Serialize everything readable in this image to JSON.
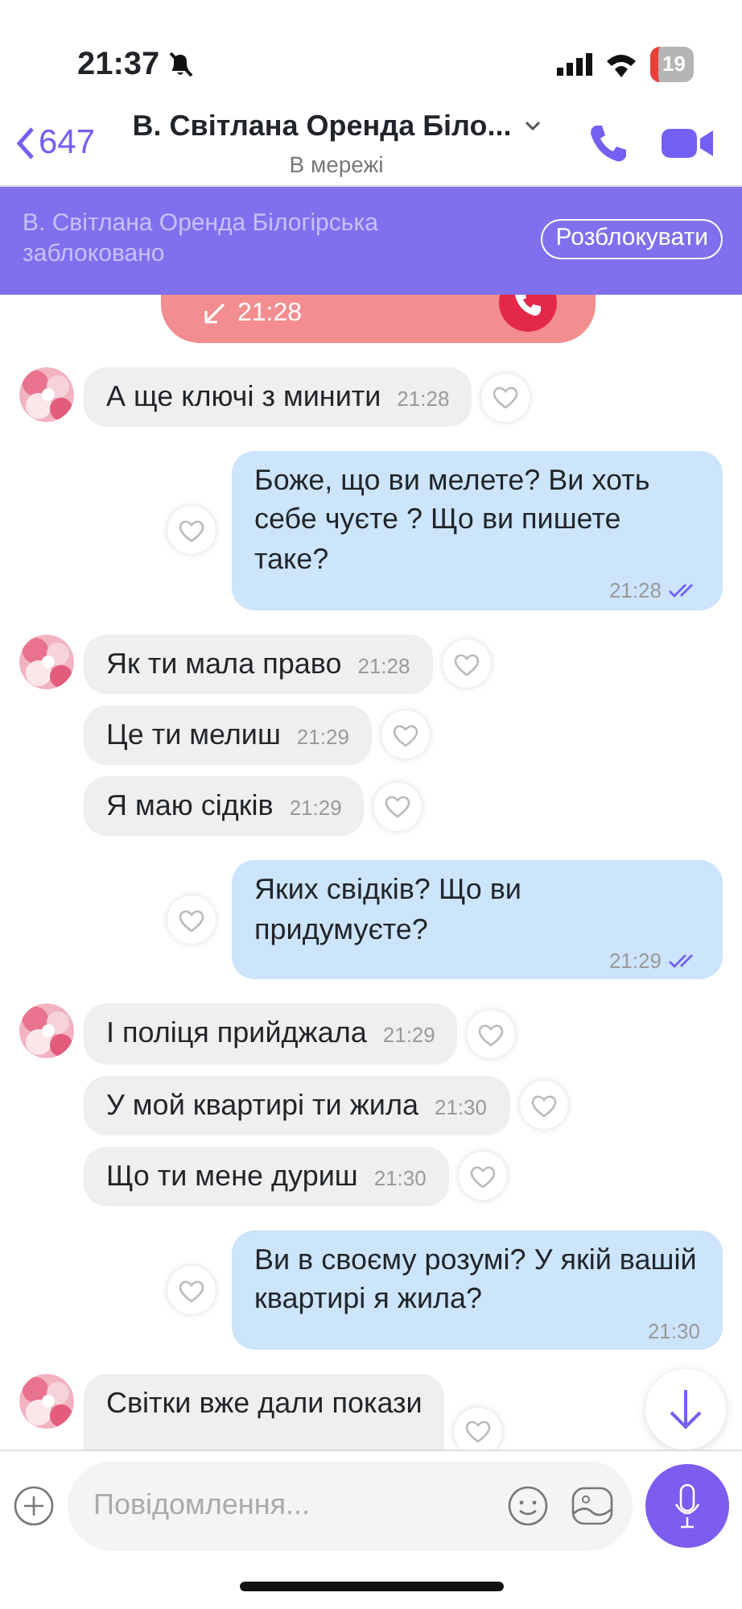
{
  "status_bar": {
    "time": "21:37",
    "battery": "19"
  },
  "header": {
    "back": "647",
    "title": "В. Світлана Оренда Біло...",
    "subtitle": "В мережі"
  },
  "blocked_banner": {
    "text": "В. Світлана Оренда Білогірська заблоковано",
    "button": "Розблокувати"
  },
  "messages": [
    {
      "kind": "call",
      "time": "21:28"
    },
    {
      "kind": "in",
      "show_avatar": true,
      "text": "А ще ключі з минити",
      "time": "21:28"
    },
    {
      "kind": "out",
      "text": "Боже, що ви мелете? Ви хоть себе чуєте ? Що ви пишете таке?",
      "time": "21:28",
      "read": true
    },
    {
      "kind": "in",
      "show_avatar": true,
      "text": "Як ти мала право",
      "time": "21:28"
    },
    {
      "kind": "in",
      "show_avatar": false,
      "text": "Це ти мелиш",
      "time": "21:29"
    },
    {
      "kind": "in",
      "show_avatar": false,
      "text": "Я маю сідків",
      "time": "21:29"
    },
    {
      "kind": "out",
      "text": "Яких свідків? Що ви придумуєте?",
      "time": "21:29",
      "read": true
    },
    {
      "kind": "in",
      "show_avatar": true,
      "text": "І поліця прийджала",
      "time": "21:29"
    },
    {
      "kind": "in",
      "show_avatar": false,
      "text": "У мой квартирі ти жила",
      "time": "21:30"
    },
    {
      "kind": "in",
      "show_avatar": false,
      "text": "Що ти мене дуриш",
      "time": "21:30"
    },
    {
      "kind": "out",
      "text": "Ви в своєму розумі? У якій вашій квартирі я жила?",
      "time": "21:30",
      "read": false
    },
    {
      "kind": "in",
      "show_avatar": true,
      "text": "Світки вже дали покази"
    }
  ],
  "composer": {
    "placeholder": "Повідомлення..."
  }
}
